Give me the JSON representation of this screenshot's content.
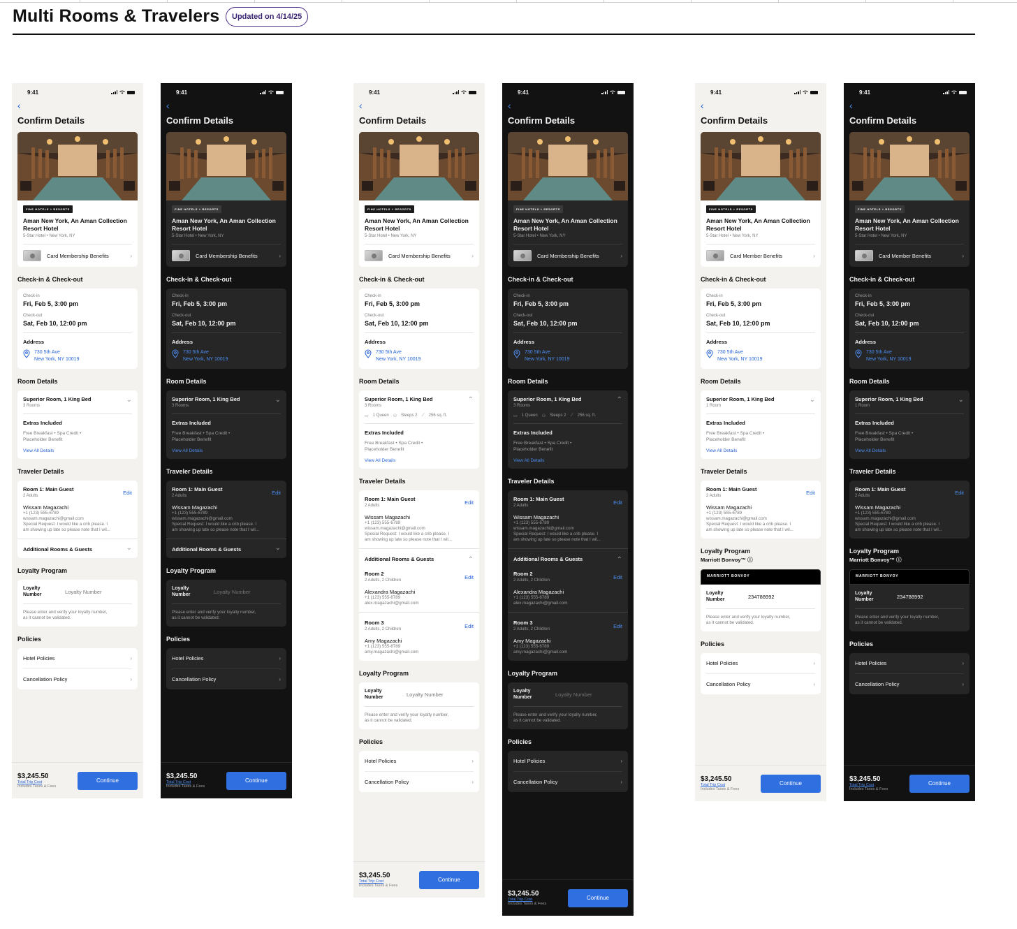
{
  "page": {
    "title": "Multi Rooms & Travelers",
    "updated_badge": "Updated on 4/14/25"
  },
  "screen": {
    "time": "9:41",
    "back_glyph": "‹",
    "heading": "Confirm Details",
    "brand_badge": "FINE HOTELS + RESORTS",
    "hotel_name": "Aman New York, An Aman Collection Resort Hotel",
    "hotel_sub": "5-Star Hotel • New York, NY",
    "benefit_label_a": "Card Membership Benefits",
    "benefit_label_b": "Card Member Benefits",
    "checkin_section": "Check-in & Check-out",
    "checkin_label": "Check-in",
    "checkin_value": "Fri, Feb 5, 3:00 pm",
    "checkout_label": "Check-out",
    "checkout_value": "Sat, Feb 10, 12:00 pm",
    "address_label": "Address",
    "address_line1": "730 5th Ave",
    "address_line2": "New York, NY 10019",
    "room_section": "Room Details",
    "room_name": "Superior Room, 1 King Bed",
    "rooms_count_a": "3 Rooms",
    "rooms_count_b": "1 Room",
    "amenity_bed": "1 Queen",
    "amenity_sleeps": "Sleeps 2",
    "amenity_size": "256 sq. ft.",
    "extras_title": "Extras Included",
    "extras_line1": "Free Breakfast  •  Spa Credit  •",
    "extras_line2": "Placeholder Benefit",
    "view_all": "View All Details",
    "traveler_section": "Traveler Details",
    "room1_title": "Room 1: Main Guest",
    "room1_sub": "2 Adults",
    "edit": "Edit",
    "guest1_name": "Wissam Magazachi",
    "guest1_phone": "+1 (123) 555-6789",
    "guest1_email": "wissam.magazachi@gmail.com",
    "guest1_req1": "Special Request: I would like a crib please. I",
    "guest1_req2": "am showing up late so please note that I wil...",
    "additional_title": "Additional Rooms & Guests",
    "room2_title": "Room 2",
    "room2_sub": "2 Adults, 2 Children",
    "guest2_name": "Alexandra Magazachi",
    "guest2_phone": "+1 (123) 555-6789",
    "guest2_email": "alex.magazachi@gmail.com",
    "room3_title": "Room 3",
    "room3_sub": "2 Adults, 2 Children",
    "guest3_name": "Amy Magazachi",
    "guest3_phone": "+1 (123) 555-6789",
    "guest3_email": "amy.magazachi@gmail.com",
    "loyalty_section": "Loyalty Program",
    "loyalty_label": "Loyalty Number",
    "loyalty_placeholder": "Loyalty Number",
    "loyalty_note1": "Please enter and verify your loyalty number,",
    "loyalty_note2": "as it cannot be validated.",
    "loyalty_program_name": "Marriott Bonvoy™ ⓘ",
    "bonvoy_logo": "MARRIOTT BONVOY",
    "loyalty_value": "234788992",
    "policies_section": "Policies",
    "hotel_policies": "Hotel Policies",
    "cancellation_policy": "Cancellation Policy",
    "price": "$3,245.50",
    "total_cost": "Total Trip Cost",
    "includes": "Includes Taxes & Fees",
    "continue": "Continue"
  },
  "colors": {
    "light_bg": "#f4f2ef",
    "dark_bg": "#121212",
    "accent": "#2f6fe0",
    "link": "#2563d6"
  },
  "icons": [
    "signal-icon",
    "wifi-icon",
    "battery-icon",
    "back-chevron-icon",
    "location-pin-icon",
    "chevron-right-icon",
    "chevron-down-icon",
    "chevron-up-icon",
    "bed-icon",
    "person-icon",
    "ruler-icon",
    "info-icon"
  ]
}
